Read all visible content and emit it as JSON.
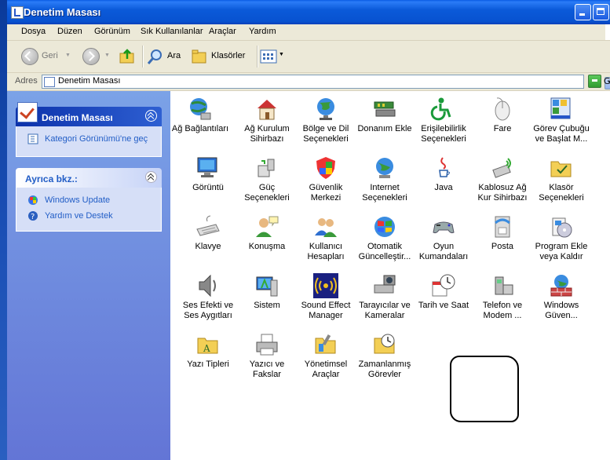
{
  "window": {
    "title": "Denetim Masası"
  },
  "menubar": {
    "items": [
      "Dosya",
      "Düzen",
      "Görünüm",
      "Sık Kullanılanlar",
      "Araçlar",
      "Yardım"
    ]
  },
  "toolbar": {
    "back": "Geri",
    "search": "Ara",
    "folders": "Klasörler"
  },
  "address": {
    "label": "Adres",
    "value": "Denetim Masası",
    "go_label": "G"
  },
  "taskpane": {
    "panel1": {
      "title": "Denetim Masası",
      "link": "Kategori Görünümü'ne geç"
    },
    "panel2": {
      "title": "Ayrıca bkz.:",
      "links": [
        "Windows Update",
        "Yardım ve Destek"
      ]
    }
  },
  "items": [
    {
      "label": "Ağ Bağlantıları",
      "icon": "network-globe-icon"
    },
    {
      "label": "Ağ Kurulum Sihirbazı",
      "icon": "home-network-icon"
    },
    {
      "label": "Bölge ve Dil Seçenekleri",
      "icon": "globe-icon"
    },
    {
      "label": "Donanım Ekle",
      "icon": "hardware-icon"
    },
    {
      "label": "Erişilebilirlik Seçenekleri",
      "icon": "accessibility-icon"
    },
    {
      "label": "Fare",
      "icon": "mouse-icon"
    },
    {
      "label": "Görev Çubuğu ve Başlat M...",
      "icon": "taskbar-icon"
    },
    {
      "label": "Görüntü",
      "icon": "display-icon"
    },
    {
      "label": "Güç Seçenekleri",
      "icon": "power-icon"
    },
    {
      "label": "Güvenlik Merkezi",
      "icon": "shield-icon"
    },
    {
      "label": "Internet Seçenekleri",
      "icon": "internet-icon"
    },
    {
      "label": "Java",
      "icon": "java-icon"
    },
    {
      "label": "Kablosuz Ağ Kur Sihirbazı",
      "icon": "wireless-icon"
    },
    {
      "label": "Klasör Seçenekleri",
      "icon": "folder-options-icon"
    },
    {
      "label": "Klavye",
      "icon": "keyboard-icon"
    },
    {
      "label": "Konuşma",
      "icon": "speech-icon"
    },
    {
      "label": "Kullanıcı Hesapları",
      "icon": "users-icon"
    },
    {
      "label": "Otomatik Güncelleştir...",
      "icon": "windows-update-icon"
    },
    {
      "label": "Oyun Kumandaları",
      "icon": "gamepad-icon"
    },
    {
      "label": "Posta",
      "icon": "mail-icon"
    },
    {
      "label": "Program Ekle veya Kaldır",
      "icon": "add-remove-icon"
    },
    {
      "label": "Ses Efekti ve Ses Aygıtları",
      "icon": "speaker-icon"
    },
    {
      "label": "Sistem",
      "icon": "system-icon"
    },
    {
      "label": "Sound Effect Manager",
      "icon": "sound-effect-icon"
    },
    {
      "label": "Tarayıcılar ve Kameralar",
      "icon": "scanner-icon"
    },
    {
      "label": "Tarih ve Saat",
      "icon": "clock-icon"
    },
    {
      "label": "Telefon ve Modem ...",
      "icon": "phone-icon"
    },
    {
      "label": "Windows Güven...",
      "icon": "firewall-icon"
    },
    {
      "label": "Yazı Tipleri",
      "icon": "fonts-icon"
    },
    {
      "label": "Yazıcı ve Fakslar",
      "icon": "printer-icon"
    },
    {
      "label": "Yönetimsel Araçlar",
      "icon": "admin-tools-icon"
    },
    {
      "label": "Zamanlanmış Görevler",
      "icon": "scheduled-tasks-icon"
    }
  ]
}
